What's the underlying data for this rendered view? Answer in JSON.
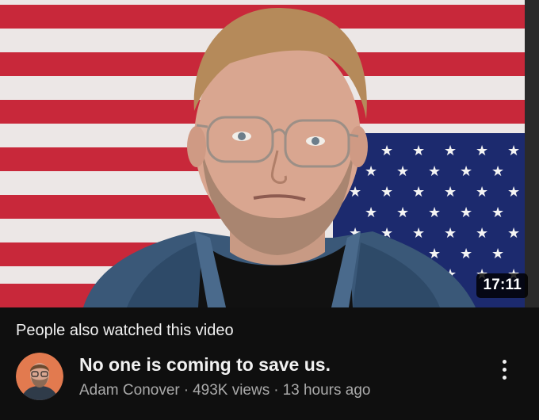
{
  "thumbnail": {
    "duration": "17:11",
    "colors": {
      "flag_red": "#c8283a",
      "flag_white": "#ece7e6",
      "flag_blue": "#1c2a6e"
    }
  },
  "section": {
    "header": "People also watched this video"
  },
  "video": {
    "title": "No one is coming to save us.",
    "channel": "Adam Conover",
    "separator": "·",
    "views": "493K views",
    "age": "13 hours ago",
    "menu_icon": "more-vert-icon"
  }
}
